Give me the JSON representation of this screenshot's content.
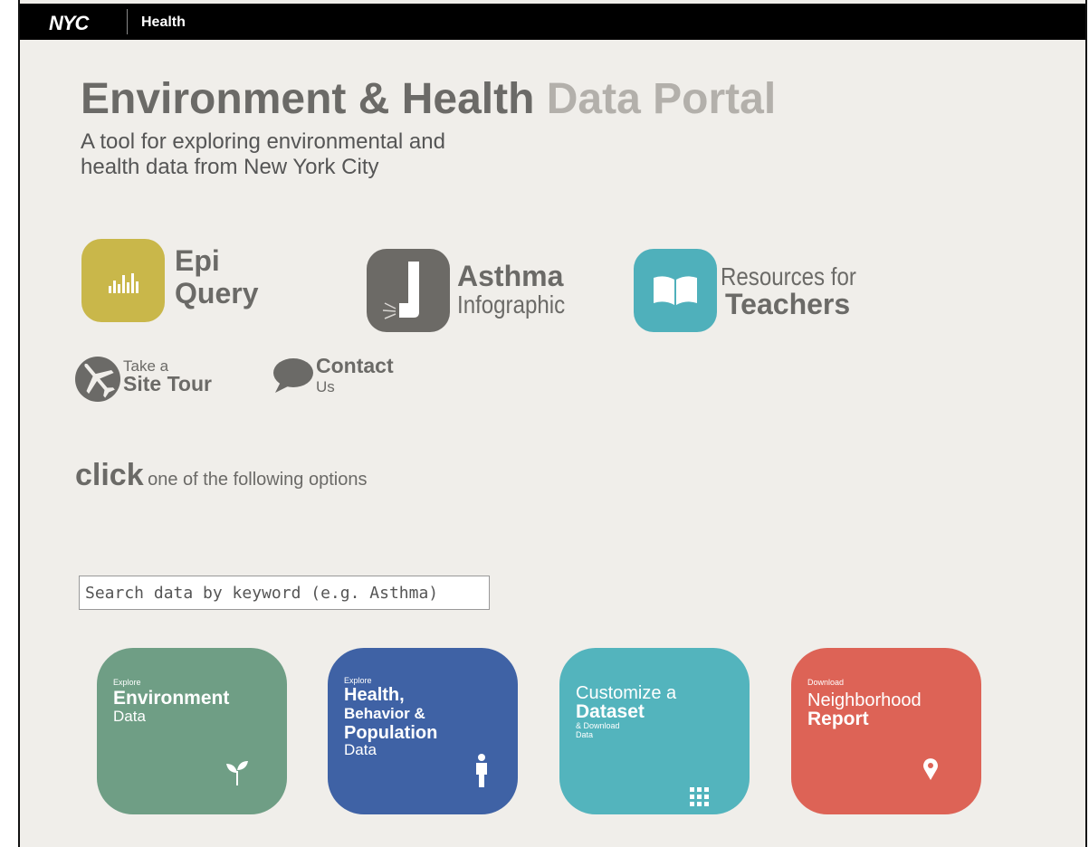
{
  "header": {
    "logo": "NYC",
    "section": "Health"
  },
  "hero": {
    "title_dark": "Environment & Health",
    "title_light": "Data Portal",
    "subtitle_line1": "A tool for exploring environmental and",
    "subtitle_line2": "health data from New York City"
  },
  "featured": [
    {
      "line1": "Epi",
      "line2": "Query",
      "icon": "bar-chart-icon",
      "color": "#c9b74a"
    },
    {
      "line1": "Asthma",
      "line2": "Infographic",
      "icon": "inhaler-icon",
      "color": "#6c6a66"
    },
    {
      "line1": "Resources for",
      "line2": "Teachers",
      "icon": "open-book-icon",
      "color": "#4fb0bb"
    }
  ],
  "links": {
    "tour": {
      "line1": "Take a",
      "line2": "Site Tour",
      "icon": "airplane-icon"
    },
    "contact": {
      "line1": "Contact",
      "line2": "Us",
      "icon": "speech-bubble-icon"
    }
  },
  "instruction": {
    "emphasis": "click",
    "rest": "one of the following options"
  },
  "search": {
    "placeholder": "Search data by keyword (e.g. Asthma)"
  },
  "cards": [
    {
      "small": "Explore",
      "big": "Environment",
      "sub": "Data",
      "icon": "sprout-icon",
      "color": "#6f9e85"
    },
    {
      "small": "Explore",
      "big1": "Health,",
      "big2": "Behavior &",
      "big3": "Population",
      "sub": "Data",
      "icon": "person-icon",
      "color": "#3f62a5"
    },
    {
      "top": "Customize a",
      "big": "Dataset",
      "small1": "& Download",
      "small2": "Data",
      "icon": "grid-icon",
      "color": "#53b4bd"
    },
    {
      "small": "Download",
      "top": "Neighborhood",
      "big": "Report",
      "icon": "map-pin-icon",
      "color": "#dd6356"
    }
  ]
}
